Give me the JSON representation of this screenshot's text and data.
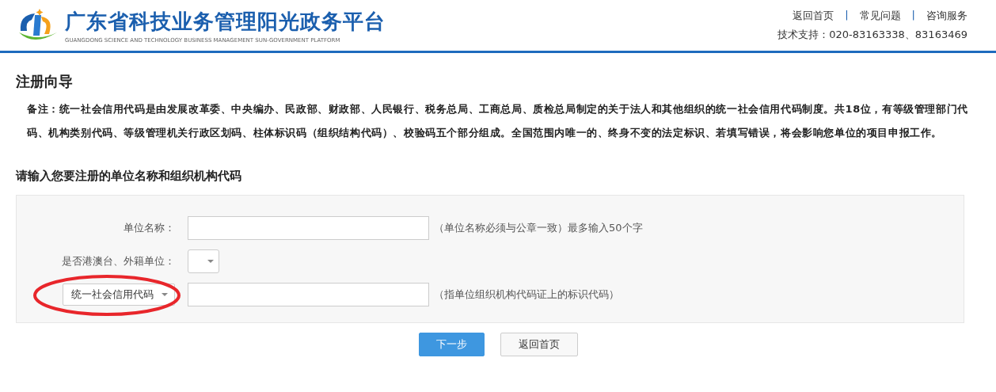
{
  "header": {
    "title": "广东省科技业务管理阳光政务平台",
    "subtitle": "GUANGDONG SCIENCE AND TECHNOLOGY BUSINESS MANAGEMENT SUN-GOVERNMENT PLATFORM",
    "links": [
      "返回首页",
      "常见问题",
      "咨询服务"
    ],
    "separator": "|",
    "support": "技术支持：020-83163338、83163469"
  },
  "page_title": "注册向导",
  "note": "备注：统一社会信用代码是由发展改革委、中央编办、民政部、财政部、人民银行、税务总局、工商总局、质检总局制定的关于法人和其他组织的统一社会信用代码制度。共18位，有等级管理部门代码、机构类别代码、等级管理机关行政区划码、柱体标识码（组织结构代码）、校验码五个部分组成。全国范围内唯一的、终身不变的法定标识、若填写错误，将会影响您单位的项目申报工作。",
  "section_title": "请输入您要注册的单位名称和组织机构代码",
  "form_rows": [
    {
      "kind": "text",
      "label": "单位名称：",
      "hint": "（单位名称必须与公章一致）最多输入50个字"
    },
    {
      "kind": "select",
      "label": "是否港澳台、外籍单位："
    },
    {
      "kind": "code",
      "select_value": "统一社会信用代码",
      "hint": "（指单位组织机构代码证上的标识代码）",
      "circled": true
    }
  ],
  "buttons": [
    {
      "label": "下一步",
      "primary": true
    },
    {
      "label": "返回首页",
      "primary": false
    }
  ]
}
